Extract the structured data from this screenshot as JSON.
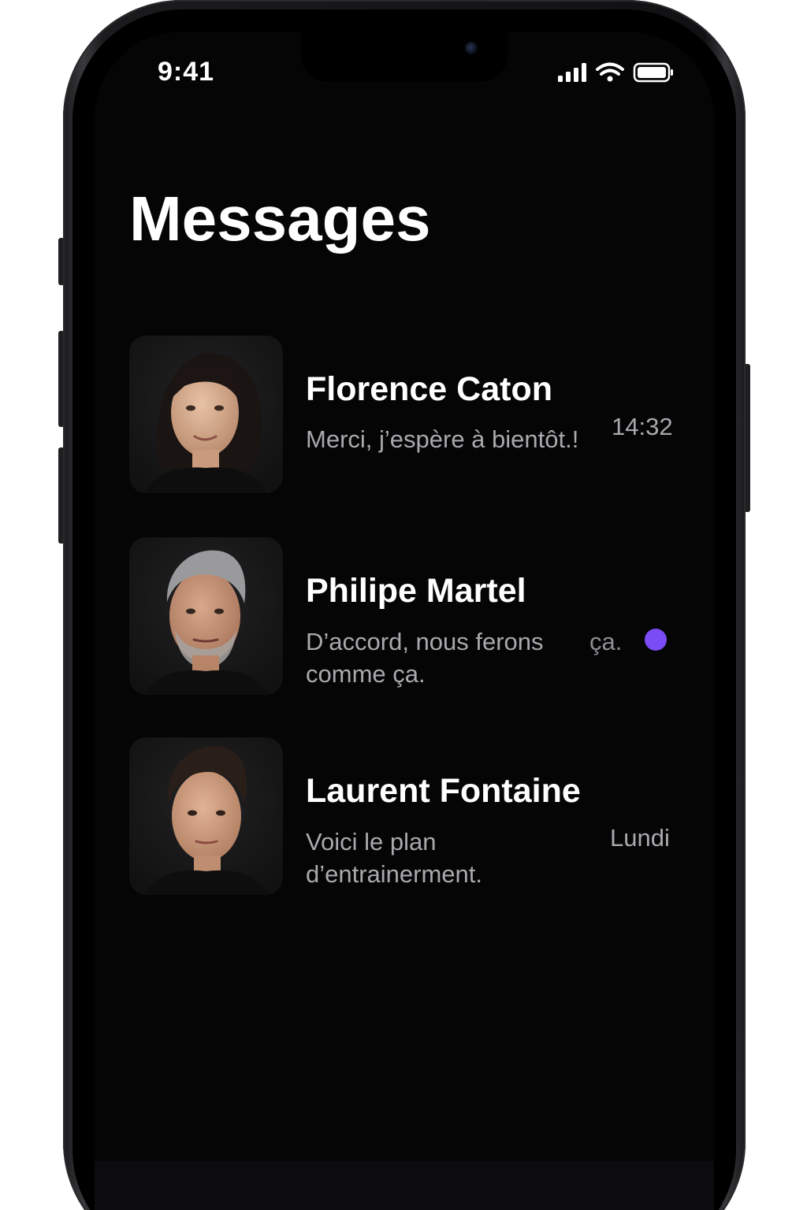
{
  "status_bar": {
    "time": "9:41",
    "icons": [
      "cellular-signal-icon",
      "wifi-icon",
      "battery-icon"
    ]
  },
  "header": {
    "title": "Messages"
  },
  "conversations": [
    {
      "name": "Florence Caton",
      "preview_line1": "Merci, j’espère à bientôt.!",
      "preview_line2": "",
      "meta": "14:32",
      "unread": false
    },
    {
      "name": "Philipe Martel",
      "preview_line1": "D’accord, nous ferons",
      "preview_fragment": "ça.",
      "preview_line2": "comme ça.",
      "meta": "",
      "unread": true
    },
    {
      "name": "Laurent Fontaine",
      "preview_line1": "Voici le plan",
      "preview_line2": "d’entrainerment.",
      "meta": "Lundi",
      "unread": false
    }
  ],
  "colors": {
    "screen_background": "#050506",
    "primary_text": "#ffffff",
    "secondary_text": "#a9a9ae",
    "unread_accent": "#7a4cf5"
  }
}
